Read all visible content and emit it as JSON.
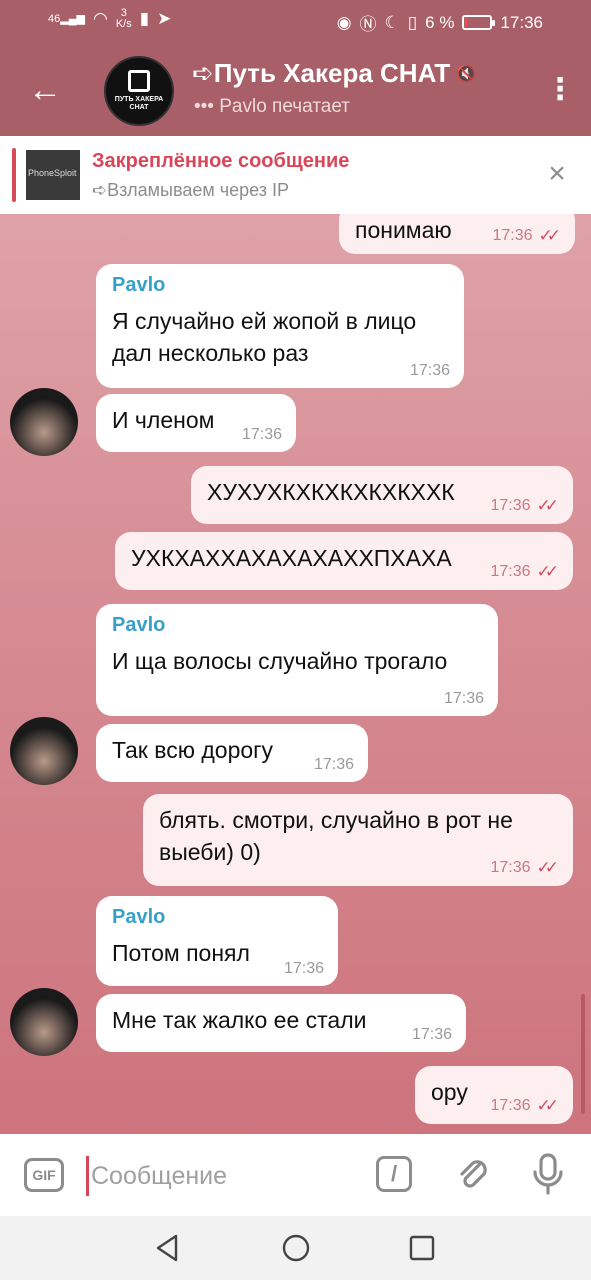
{
  "status_bar": {
    "signal": "46",
    "speed_value": "3",
    "speed_unit": "K/s",
    "battery": "6 %",
    "battery_level": 0.06,
    "time": "17:36",
    "icons": [
      "signal-icon",
      "wifi-icon",
      "sim-icon",
      "telegram-icon",
      "eye-icon",
      "nfc-icon",
      "moon-icon",
      "vibrate-icon",
      "battery-icon"
    ]
  },
  "header": {
    "title": "➪Путь Хакера CHAT",
    "typing": "••• Pavlo печатает",
    "avatar_text": "ПУТЬ ХАКЕРА CHAT",
    "icons": [
      "back-arrow-icon",
      "muted-icon",
      "more-vert-icon"
    ]
  },
  "pinned": {
    "title": "Закреплённое сообщение",
    "subtitle": "➪Взламываем через IP",
    "thumb_text": "PhoneSploit"
  },
  "messages": [
    {
      "dir": "out",
      "text": "понимаю",
      "time": "17:36"
    },
    {
      "dir": "in",
      "sender": "Pavlo",
      "text": "Я случайно ей жопой в лицо дал несколько раз",
      "time": "17:36"
    },
    {
      "dir": "in",
      "text": "И членом",
      "time": "17:36"
    },
    {
      "dir": "out",
      "text": "ХУХУХКХКХКХКХКХХК",
      "time": "17:36"
    },
    {
      "dir": "out",
      "text": "УХКХАХХАХАХАХАХХПХАХА",
      "time": "17:36"
    },
    {
      "dir": "in",
      "sender": "Pavlo",
      "text": "И ща волосы случайно трогало",
      "time": "17:36"
    },
    {
      "dir": "in",
      "text": "Так всю дорогу",
      "time": "17:36"
    },
    {
      "dir": "out",
      "text": "блять. смотри, случайно в рот не выеби) 0)",
      "time": "17:36"
    },
    {
      "dir": "in",
      "sender": "Pavlo",
      "text": "Потом понял",
      "time": "17:36"
    },
    {
      "dir": "in",
      "text": "Мне так жалко ее стали",
      "time": "17:36"
    },
    {
      "dir": "out",
      "text": "ору",
      "time": "17:36"
    }
  ],
  "composer": {
    "placeholder": "Сообщение",
    "gif_label": "GIF",
    "slash_label": "/"
  },
  "colors": {
    "header": "#a95f68",
    "accent": "#d9465a",
    "sender": "#37a0c9",
    "ticks": "#d05060"
  }
}
